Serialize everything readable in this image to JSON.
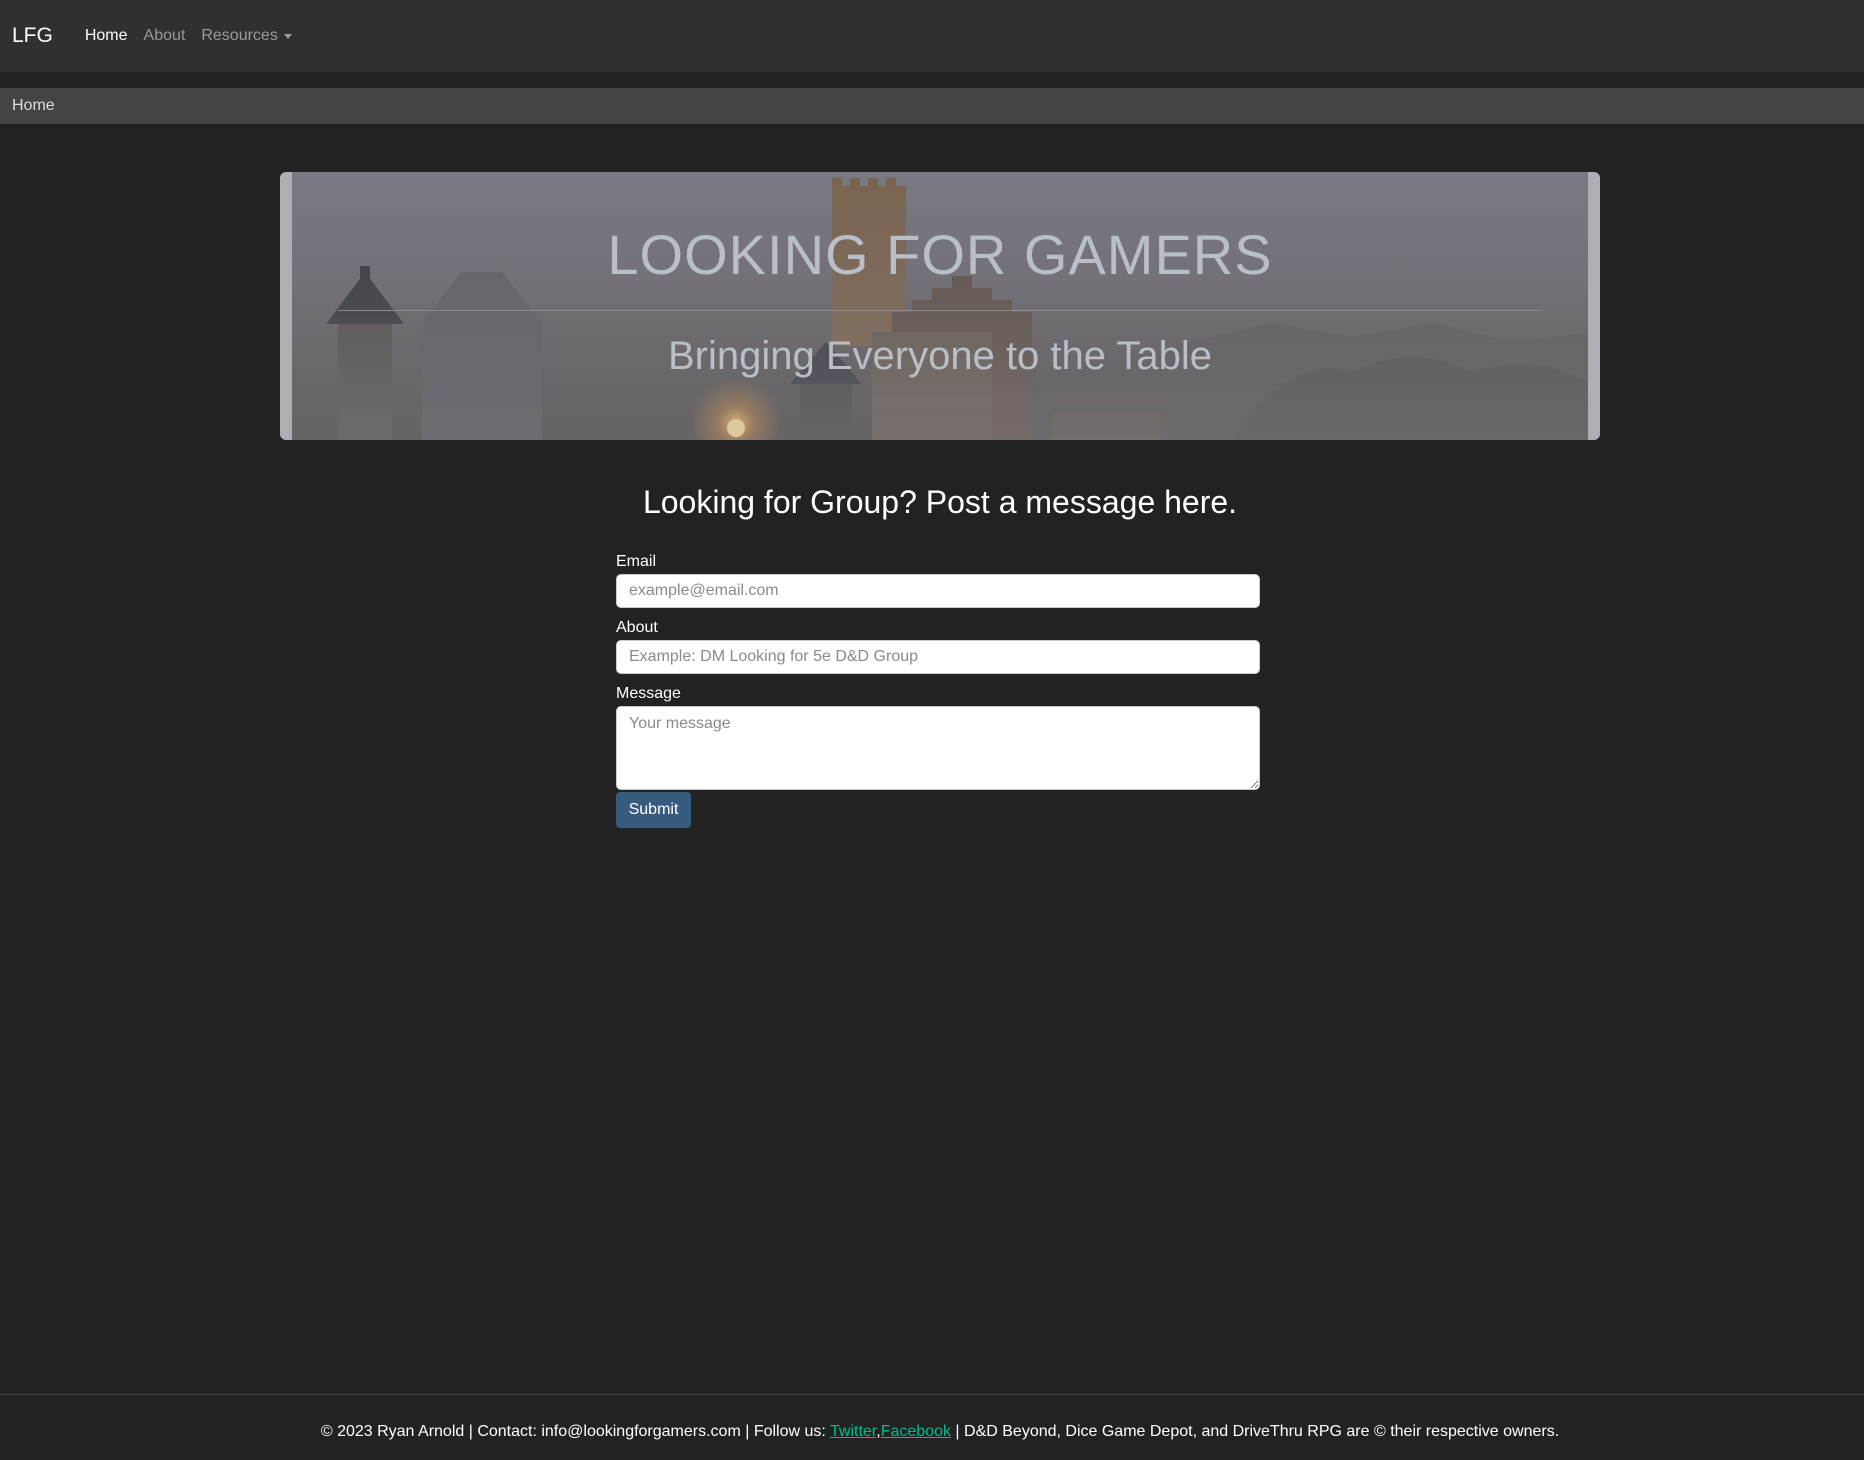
{
  "navbar": {
    "brand": "LFG",
    "links": [
      {
        "label": "Home"
      },
      {
        "label": "About"
      },
      {
        "label": "Resources"
      }
    ]
  },
  "breadcrumb": {
    "current": "Home"
  },
  "hero": {
    "title": "LOOKING FOR GAMERS",
    "subtitle": "Bringing Everyone to the Table"
  },
  "form": {
    "heading": "Looking for Group? Post a message here.",
    "email_label": "Email",
    "email_placeholder": "example@email.com",
    "about_label": "About",
    "about_placeholder": "Example: DM Looking for 5e D&D Group",
    "message_label": "Message",
    "message_placeholder": "Your message",
    "submit_label": "Submit"
  },
  "footer": {
    "prefix": "© 2023 Ryan Arnold | Contact: info@lookingforgamers.com | Follow us: ",
    "twitter": "Twitter",
    "separator": ",",
    "facebook": "Facebook",
    "suffix": " | D&D Beyond, Dice Game Depot, and DriveThru RPG are © their respective owners.",
    "link_color": "#00bc8c"
  },
  "colors": {
    "background": "#222222",
    "navbar": "#303030",
    "breadcrumb": "#444444",
    "primary": "#375a7f"
  }
}
